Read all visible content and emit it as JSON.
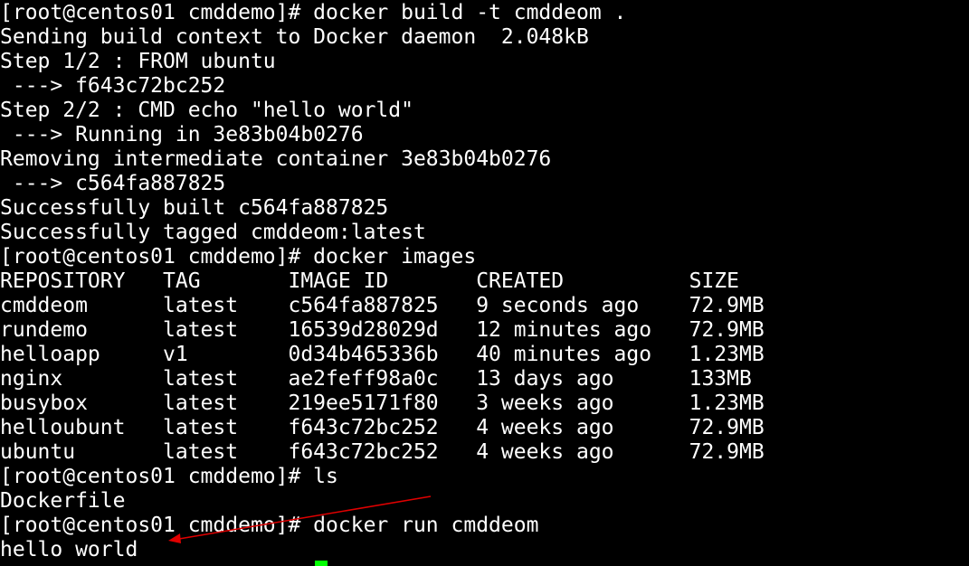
{
  "terminal": {
    "lines": [
      "[root@centos01 cmddemo]# docker build -t cmddeom .",
      "Sending build context to Docker daemon  2.048kB",
      "Step 1/2 : FROM ubuntu",
      " ---> f643c72bc252",
      "Step 2/2 : CMD echo \"hello world\"",
      " ---> Running in 3e83b04b0276",
      "Removing intermediate container 3e83b04b0276",
      " ---> c564fa887825",
      "Successfully built c564fa887825",
      "Successfully tagged cmddeom:latest",
      "[root@centos01 cmddemo]# docker images",
      "REPOSITORY   TAG       IMAGE ID       CREATED          SIZE",
      "cmddeom      latest    c564fa887825   9 seconds ago    72.9MB",
      "rundemo      latest    16539d28029d   12 minutes ago   72.9MB",
      "helloapp     v1        0d34b465336b   40 minutes ago   1.23MB",
      "nginx        latest    ae2feff98a0c   13 days ago      133MB",
      "busybox      latest    219ee5171f80   3 weeks ago      1.23MB",
      "helloubunt   latest    f643c72bc252   4 weeks ago      72.9MB",
      "ubuntu       latest    f643c72bc252   4 weeks ago      72.9MB",
      "[root@centos01 cmddemo]# ls",
      "Dockerfile",
      "[root@centos01 cmddemo]# docker run cmddeom",
      "hello world"
    ],
    "colors": {
      "background": "#000000",
      "text": "#ffffff",
      "cursor": "#00ff00",
      "annotation_arrow": "#e00000"
    }
  }
}
